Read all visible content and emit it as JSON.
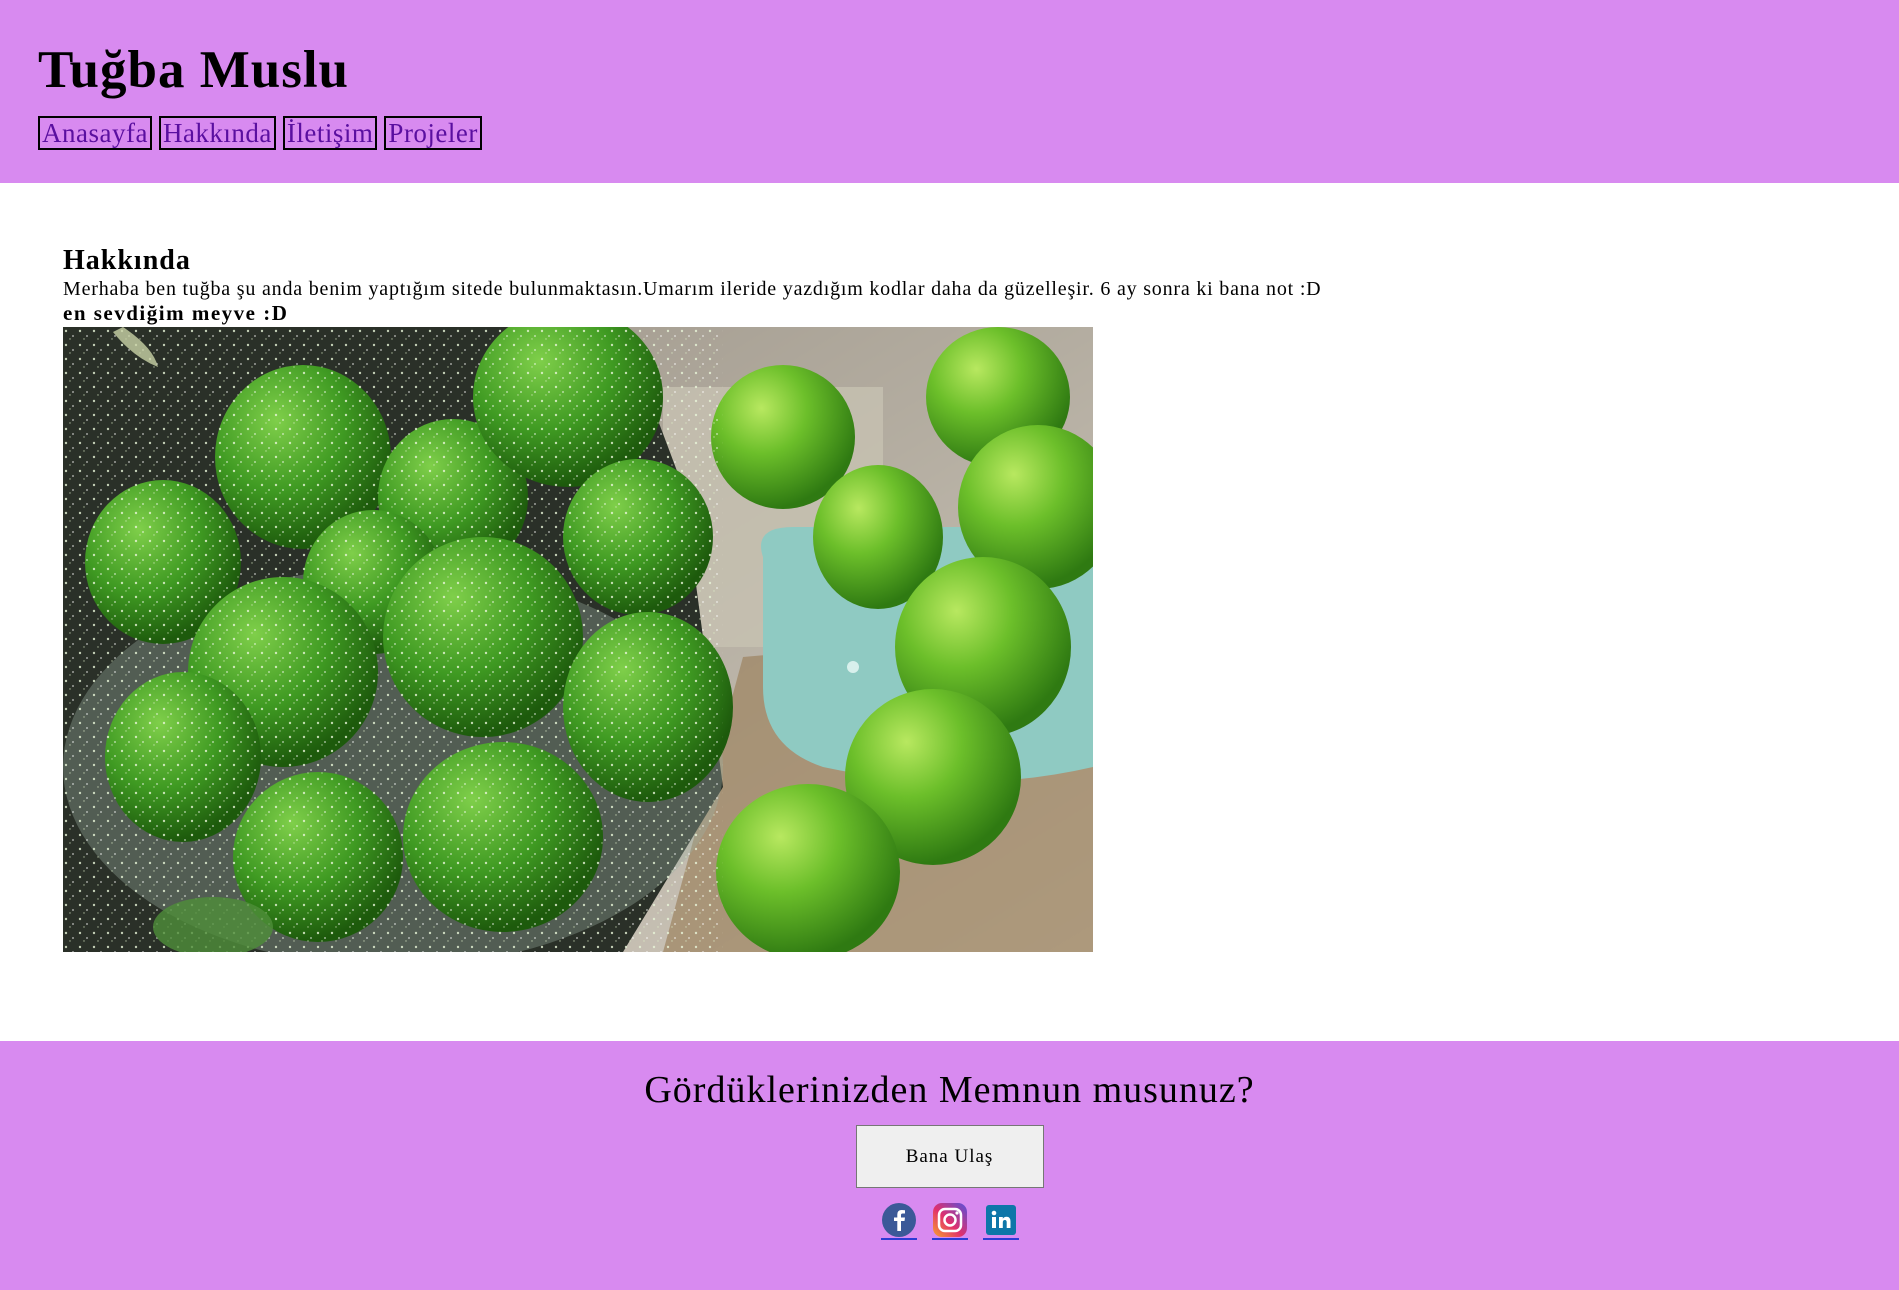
{
  "header": {
    "title": "Tuğba Muslu",
    "nav": [
      "Anasayfa",
      "Hakkında",
      "İletişim",
      "Projeler"
    ]
  },
  "main": {
    "heading": "Hakkında",
    "text": "Merhaba ben tuğba şu anda benim yaptığım sitede bulunmaktasın.Umarım ileride yazdığım kodlar daha da güzelleşir. 6 ay sonra ki bana not :D",
    "favorite_heading": "en sevdiğim meyve :D",
    "image_subject": "green plums (erik) in bowls, some sprinkled with salt"
  },
  "footer": {
    "question": "Gördüklerinizden Memnun musunuz?",
    "button_label": "Bana Ulaş",
    "social_icons": [
      "facebook-icon",
      "instagram-icon",
      "linkedin-icon"
    ]
  },
  "colors": {
    "header_footer_bg": "#d88af0",
    "nav_link": "#5a0fa0",
    "facebook": "#3b5998",
    "linkedin": "#0e76a8"
  }
}
